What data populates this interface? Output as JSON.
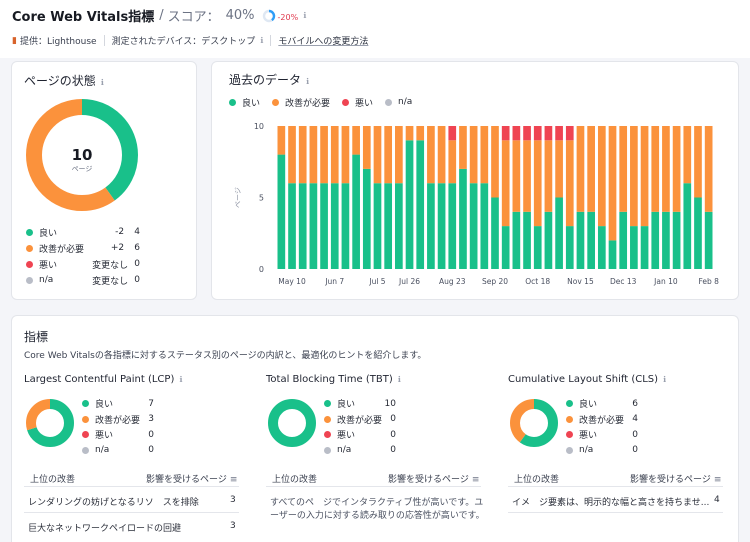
{
  "header": {
    "title": "Core Web Vitals指標",
    "separator": "/",
    "score_label": "スコア：",
    "score_value": "40%",
    "score_fraction": 0.4,
    "score_delta": "-20%",
    "provider": "提供：Lighthouse",
    "device": "測定されたデバイス：デスクトップ",
    "mobile_link": "モバイルへの変更方法"
  },
  "colors": {
    "good": "#19c08a",
    "needs_improvement": "#fb923c",
    "poor": "#ef4452",
    "na": "#b9bdc7",
    "accent": "#2e9df7"
  },
  "page_status": {
    "title": "ページの状態",
    "total": "10",
    "total_label": "ページ",
    "rows": [
      {
        "label": "良い",
        "change": "-2",
        "value": "4",
        "count": 4,
        "key": "good"
      },
      {
        "label": "改善が必要",
        "change": "+2",
        "value": "6",
        "count": 6,
        "key": "needs_improvement"
      },
      {
        "label": "悪い",
        "change": "変更なし",
        "value": "0",
        "count": 0,
        "key": "poor"
      },
      {
        "label": "n/a",
        "change": "変更なし",
        "value": "0",
        "count": 0,
        "key": "na"
      }
    ]
  },
  "history": {
    "title": "過去のデータ",
    "legend": [
      "良い",
      "改善が必要",
      "悪い",
      "n/a"
    ],
    "ylabel": "ページ"
  },
  "chart_data": {
    "type": "bar",
    "stacked": true,
    "ylim": [
      0,
      10
    ],
    "ylabel": "ページ",
    "yticks": [
      "0",
      "5",
      "10"
    ],
    "xticks": [
      "May 10",
      "Jun 7",
      "Jul 5",
      "Jul 26",
      "Aug 23",
      "Sep 20",
      "Oct 18",
      "Nov 15",
      "Dec 13",
      "Jan 10",
      "Feb 8"
    ],
    "xtick_bar_index": [
      1,
      5,
      9,
      12,
      16,
      20,
      24,
      28,
      32,
      36,
      40
    ],
    "series": [
      {
        "name": "良い",
        "values": [
          8,
          6,
          6,
          6,
          6,
          6,
          6,
          8,
          7,
          6,
          6,
          6,
          9,
          9,
          6,
          6,
          6,
          7,
          6,
          6,
          5,
          3,
          4,
          4,
          3,
          4,
          5,
          3,
          4,
          4,
          3,
          2,
          4,
          3,
          3,
          4,
          4,
          4,
          6,
          5,
          4
        ]
      },
      {
        "name": "改善が必要",
        "values": [
          2,
          4,
          4,
          4,
          4,
          4,
          4,
          2,
          3,
          4,
          4,
          4,
          1,
          1,
          4,
          4,
          3,
          3,
          4,
          4,
          5,
          6,
          5,
          5,
          6,
          5,
          4,
          6,
          6,
          6,
          7,
          8,
          6,
          7,
          7,
          6,
          6,
          6,
          4,
          5,
          6
        ]
      },
      {
        "name": "悪い",
        "values": [
          0,
          0,
          0,
          0,
          0,
          0,
          0,
          0,
          0,
          0,
          0,
          0,
          0,
          0,
          0,
          0,
          1,
          0,
          0,
          0,
          0,
          1,
          1,
          1,
          1,
          1,
          1,
          1,
          0,
          0,
          0,
          0,
          0,
          0,
          0,
          0,
          0,
          0,
          0,
          0,
          0
        ]
      },
      {
        "name": "n/a",
        "values": [
          0,
          0,
          0,
          0,
          0,
          0,
          0,
          0,
          0,
          0,
          0,
          0,
          0,
          0,
          0,
          0,
          0,
          0,
          0,
          0,
          0,
          0,
          0,
          0,
          0,
          0,
          0,
          0,
          0,
          0,
          0,
          0,
          0,
          0,
          0,
          0,
          0,
          0,
          0,
          0,
          0
        ]
      }
    ]
  },
  "metrics": {
    "title": "指標",
    "description": "Core Web Vitalsの各指標に対するステータス別のページの内訳と、最適化のヒントを紹介します。",
    "items": [
      {
        "title": "Largest Contentful Paint (LCP)",
        "rows": [
          {
            "label": "良い",
            "value": "7",
            "count": 7
          },
          {
            "label": "改善が必要",
            "value": "3",
            "count": 3
          },
          {
            "label": "悪い",
            "value": "0",
            "count": 0
          },
          {
            "label": "n/a",
            "value": "0",
            "count": 0
          }
        ],
        "col_left": "上位の改善",
        "col_right": "影響を受けるページ",
        "tips": [
          {
            "text": "レンダリングの妨げとなるリソ　スを排除",
            "count": "3"
          },
          {
            "text": "巨大なネットワークペイロードの回避",
            "count": "3"
          }
        ]
      },
      {
        "title": "Total Blocking Time (TBT)",
        "rows": [
          {
            "label": "良い",
            "value": "10",
            "count": 10
          },
          {
            "label": "改善が必要",
            "value": "0",
            "count": 0
          },
          {
            "label": "悪い",
            "value": "0",
            "count": 0
          },
          {
            "label": "n/a",
            "value": "0",
            "count": 0
          }
        ],
        "col_left": "上位の改善",
        "col_right": "影響を受けるページ",
        "tips": [
          {
            "text": "すべてのペ　ジでインタラクティブ性が高いです。ユ",
            "count": ""
          },
          {
            "text": "ーザーの入力に対する読み取りの応答性が高いです。",
            "count": ""
          }
        ]
      },
      {
        "title": "Cumulative Layout Shift (CLS)",
        "rows": [
          {
            "label": "良い",
            "value": "6",
            "count": 6
          },
          {
            "label": "改善が必要",
            "value": "4",
            "count": 4
          },
          {
            "label": "悪い",
            "value": "0",
            "count": 0
          },
          {
            "label": "n/a",
            "value": "0",
            "count": 0
          }
        ],
        "col_left": "上位の改善",
        "col_right": "影響を受けるページ",
        "tips": [
          {
            "text": "イメ　ジ要素は、明示的な幅と高さを持ちませ...",
            "count": "4"
          }
        ]
      }
    ]
  }
}
